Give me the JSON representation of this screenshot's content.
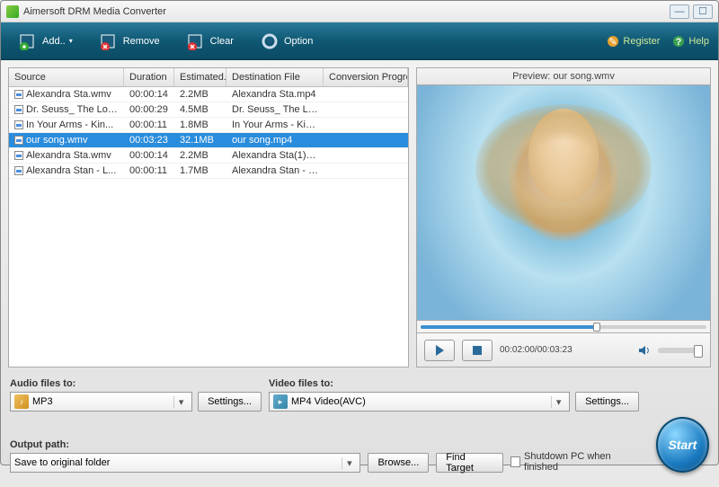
{
  "window": {
    "title": "Aimersoft DRM Media Converter"
  },
  "toolbar": {
    "add": "Add..",
    "remove": "Remove",
    "clear": "Clear",
    "option": "Option",
    "register": "Register",
    "help": "Help"
  },
  "columns": {
    "source": "Source",
    "duration": "Duration",
    "estimated": "Estimated...",
    "destination": "Destination File",
    "progress": "Conversion Progress"
  },
  "files": [
    {
      "source": "Alexandra Sta.wmv",
      "duration": "00:00:14",
      "est": "2.2MB",
      "dest": "Alexandra Sta.mp4",
      "selected": false
    },
    {
      "source": "Dr. Seuss_ The Lor...",
      "duration": "00:00:29",
      "est": "4.5MB",
      "dest": "Dr. Seuss_ The Lora...",
      "selected": false
    },
    {
      "source": "In Your Arms - Kin...",
      "duration": "00:00:11",
      "est": "1.8MB",
      "dest": "In Your Arms - Kina ...",
      "selected": false
    },
    {
      "source": "our song.wmv",
      "duration": "00:03:23",
      "est": "32.1MB",
      "dest": "our song.mp4",
      "selected": true
    },
    {
      "source": "Alexandra Sta.wmv",
      "duration": "00:00:14",
      "est": "2.2MB",
      "dest": "Alexandra Sta(1).mp4",
      "selected": false
    },
    {
      "source": "Alexandra Stan - L...",
      "duration": "00:00:11",
      "est": "1.7MB",
      "dest": "Alexandra Stan - Le...",
      "selected": false
    }
  ],
  "preview": {
    "title": "Preview: our song.wmv",
    "time": "00:02:00/00:03:23"
  },
  "output": {
    "audio_label": "Audio files to:",
    "audio_value": "MP3",
    "video_label": "Video files to:",
    "video_value": "MP4 Video(AVC)",
    "settings": "Settings...",
    "path_label": "Output path:",
    "path_value": "Save to original folder",
    "browse": "Browse...",
    "find": "Find Target",
    "shutdown": "Shutdown PC when finished",
    "start": "Start"
  }
}
